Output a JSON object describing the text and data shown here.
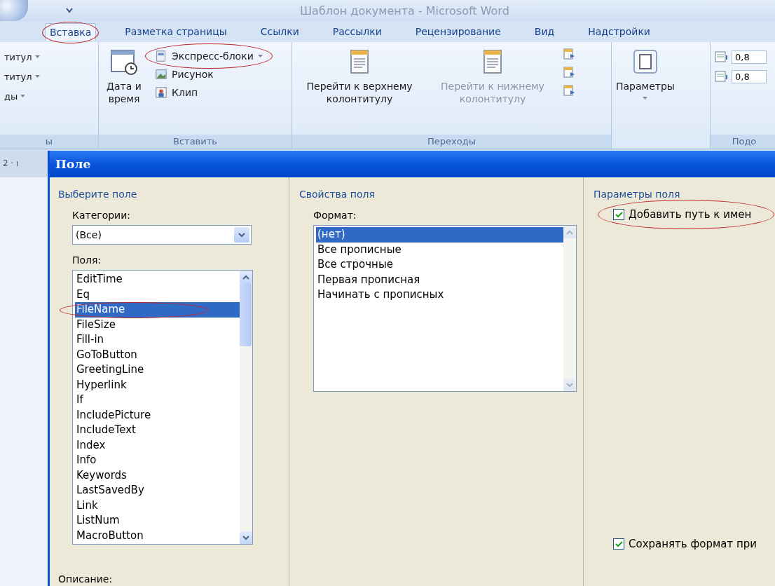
{
  "window": {
    "title": "Шаблон документа - Microsoft Word"
  },
  "tabs": [
    {
      "label": "Вставка",
      "selected": true,
      "circled": true
    },
    {
      "label": "Разметка страницы",
      "selected": false,
      "circled": false
    },
    {
      "label": "Ссылки",
      "selected": false,
      "circled": false
    },
    {
      "label": "Рассылки",
      "selected": false,
      "circled": false
    },
    {
      "label": "Рецензирование",
      "selected": false,
      "circled": false
    },
    {
      "label": "Вид",
      "selected": false,
      "circled": false
    },
    {
      "label": "Надстройки",
      "selected": false,
      "circled": false
    }
  ],
  "ribbon": {
    "groups": [
      {
        "label": "ы",
        "items": [
          {
            "kind": "text",
            "label": "титул"
          },
          {
            "kind": "text",
            "label": "титул"
          },
          {
            "kind": "text",
            "label": "ды"
          }
        ]
      },
      {
        "label": "Вставить",
        "items": [
          {
            "kind": "large",
            "label": "Дата и время",
            "disabled": false
          },
          {
            "kind": "small",
            "label": "Экспресс-блоки",
            "dropdown": true,
            "circled": true
          },
          {
            "kind": "small",
            "label": "Рисунок",
            "dropdown": false,
            "circled": false
          },
          {
            "kind": "small",
            "label": "Клип",
            "dropdown": false,
            "circled": false
          }
        ]
      },
      {
        "label": "Переходы",
        "items": [
          {
            "kind": "large",
            "label": "Перейти к верхнему колонтитулу",
            "disabled": false
          },
          {
            "kind": "large",
            "label": "Перейти к нижнему колонтитулу",
            "disabled": true
          },
          {
            "kind": "icons"
          }
        ]
      },
      {
        "items": [
          {
            "kind": "large",
            "label": "Параметры",
            "disabled": false
          }
        ]
      },
      {
        "label": "Подо",
        "items": [
          {
            "kind": "spin",
            "value": "0,8"
          },
          {
            "kind": "spin",
            "value": "0,8"
          }
        ]
      }
    ]
  },
  "ruler": {
    "text": "2 · ı"
  },
  "dialog": {
    "title": "Поле",
    "choose": {
      "heading": "Выберите поле",
      "categories_label": "Категории:",
      "categories_value": "(Все)",
      "fields_label": "Поля:",
      "fields": [
        {
          "label": "EditTime",
          "selected": false,
          "circled": false
        },
        {
          "label": "Eq",
          "selected": false,
          "circled": false
        },
        {
          "label": "FileName",
          "selected": true,
          "circled": true
        },
        {
          "label": "FileSize",
          "selected": false,
          "circled": false
        },
        {
          "label": "Fill-in",
          "selected": false,
          "circled": false
        },
        {
          "label": "GoToButton",
          "selected": false,
          "circled": false
        },
        {
          "label": "GreetingLine",
          "selected": false,
          "circled": false
        },
        {
          "label": "Hyperlink",
          "selected": false,
          "circled": false
        },
        {
          "label": "If",
          "selected": false,
          "circled": false
        },
        {
          "label": "IncludePicture",
          "selected": false,
          "circled": false
        },
        {
          "label": "IncludeText",
          "selected": false,
          "circled": false
        },
        {
          "label": "Index",
          "selected": false,
          "circled": false
        },
        {
          "label": "Info",
          "selected": false,
          "circled": false
        },
        {
          "label": "Keywords",
          "selected": false,
          "circled": false
        },
        {
          "label": "LastSavedBy",
          "selected": false,
          "circled": false
        },
        {
          "label": "Link",
          "selected": false,
          "circled": false
        },
        {
          "label": "ListNum",
          "selected": false,
          "circled": false
        },
        {
          "label": "MacroButton",
          "selected": false,
          "circled": false
        }
      ],
      "description_label": "Описание:"
    },
    "properties": {
      "heading": "Свойства поля",
      "format_label": "Формат:",
      "formats": [
        {
          "label": "(нет)",
          "selected": true
        },
        {
          "label": "Все прописные",
          "selected": false
        },
        {
          "label": "Все строчные",
          "selected": false
        },
        {
          "label": "Первая прописная",
          "selected": false
        },
        {
          "label": "Начинать с прописных",
          "selected": false
        }
      ]
    },
    "options": {
      "heading": "Параметры поля",
      "checkboxes": [
        {
          "label": "Добавить путь к имен",
          "checked": true,
          "circled": true
        },
        {
          "label": "Сохранять формат при",
          "checked": true,
          "circled": false
        }
      ]
    }
  }
}
